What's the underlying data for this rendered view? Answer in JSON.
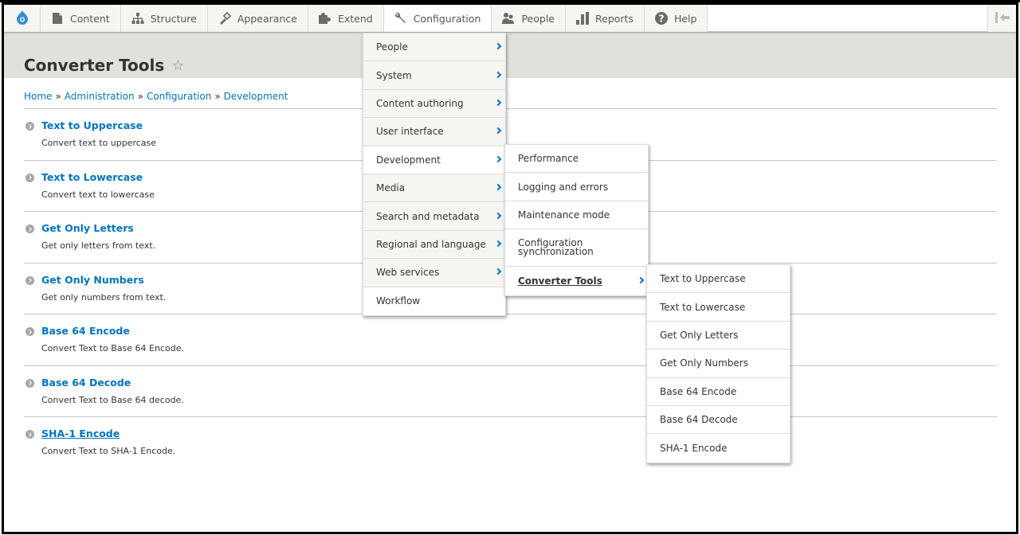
{
  "toolbar": {
    "logo": "drupal-logo",
    "items": [
      {
        "label": "Content",
        "icon": "document-icon"
      },
      {
        "label": "Structure",
        "icon": "sitemap-icon"
      },
      {
        "label": "Appearance",
        "icon": "paintbrush-icon"
      },
      {
        "label": "Extend",
        "icon": "puzzle-icon"
      },
      {
        "label": "Configuration",
        "icon": "wrench-icon",
        "active": true
      },
      {
        "label": "People",
        "icon": "people-icon"
      },
      {
        "label": "Reports",
        "icon": "bar-chart-icon"
      },
      {
        "label": "Help",
        "icon": "help-icon"
      }
    ],
    "collapse_icon": "collapse-icon"
  },
  "page": {
    "title": "Converter Tools",
    "star_glyph": "☆"
  },
  "breadcrumb": {
    "items": [
      "Home",
      "Administration",
      "Configuration",
      "Development"
    ],
    "separator": "»"
  },
  "admin_list": [
    {
      "title": "Text to Uppercase",
      "description": "Convert text to uppercase"
    },
    {
      "title": "Text to Lowercase",
      "description": "Convert text to lowercase"
    },
    {
      "title": "Get Only Letters",
      "description": "Get only letters from text."
    },
    {
      "title": "Get Only Numbers",
      "description": "Get only numbers from text."
    },
    {
      "title": "Base 64 Encode",
      "description": "Convert Text to Base 64 Encode."
    },
    {
      "title": "Base 64 Decode",
      "description": "Convert Text to Base 64 decode."
    },
    {
      "title": "SHA-1 Encode",
      "description": "Convert Text to SHA-1 Encode."
    }
  ],
  "menus": {
    "configuration": [
      "People",
      "System",
      "Content authoring",
      "User interface",
      "Development",
      "Media",
      "Search and metadata",
      "Regional and language",
      "Web services",
      "Workflow"
    ],
    "development": [
      "Performance",
      "Logging and errors",
      "Maintenance mode",
      "Configuration synchronization",
      "Converter Tools"
    ],
    "converter_tools": [
      "Text to Uppercase",
      "Text to Lowercase",
      "Get Only Letters",
      "Get Only Numbers",
      "Base 64 Encode",
      "Base 64 Decode",
      "SHA-1 Encode"
    ]
  },
  "colors": {
    "link": "#0074bd",
    "header_band": "#e1e1db",
    "menu_bg": "#f5f5f2"
  }
}
